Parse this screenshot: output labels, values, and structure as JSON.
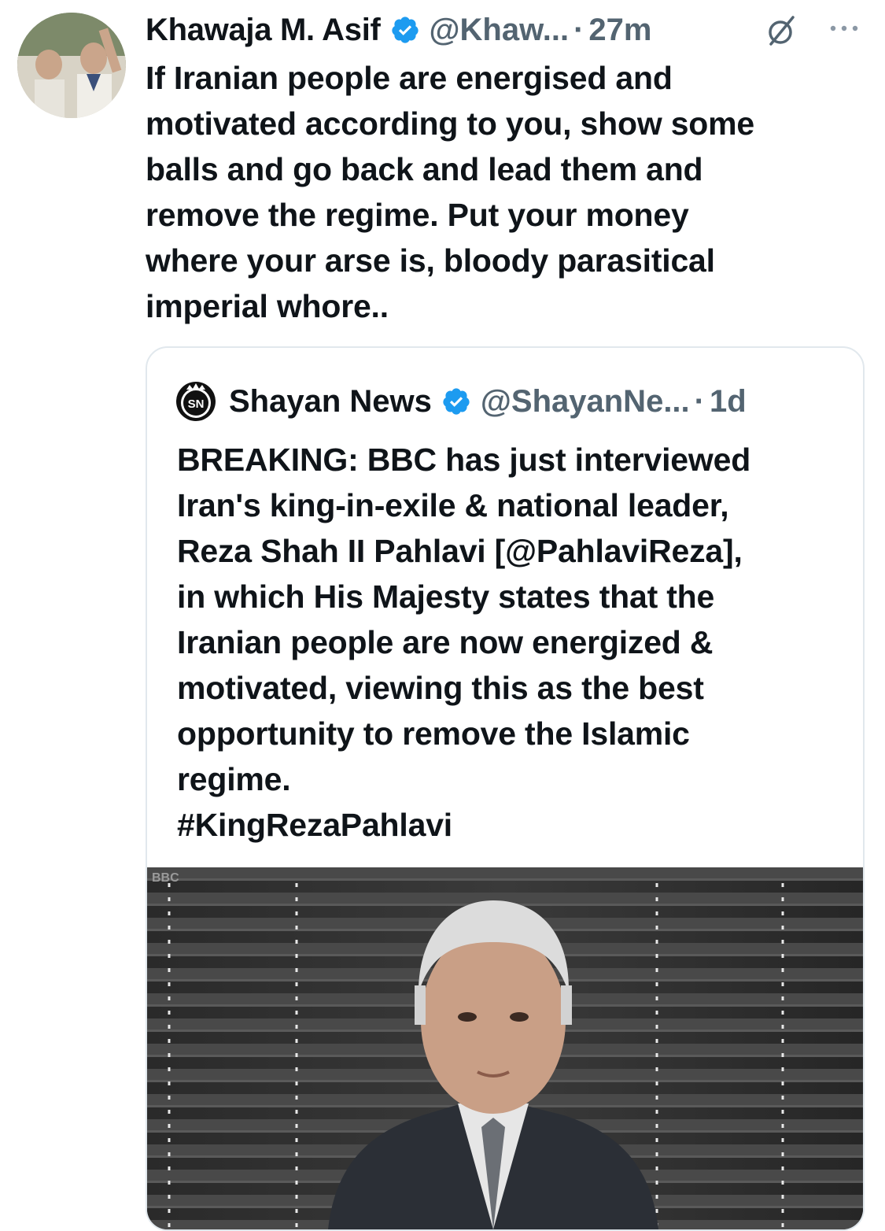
{
  "tweet": {
    "author_name": "Khawaja M. Asif",
    "handle": "@Khaw...",
    "separator": "·",
    "time": "27m",
    "text": "If Iranian people are energised and\nmotivated according to you, show some\nballs and go back and lead them and\nremove the regime. Put your money\nwhere your arse is, bloody parasitical\nimperial whore..",
    "icons": {
      "verified": "verified-badge-icon",
      "grok": "grok-icon",
      "more": "more-options-icon"
    }
  },
  "quoted": {
    "author_name": "Shayan News",
    "avatar_text": "SN",
    "handle": "@ShayanNe...",
    "separator": "·",
    "time": "1d",
    "text": "BREAKING: BBC has just interviewed\nIran's king-in-exile & national leader,\nReza Shah II Pahlavi [@PahlaviReza],\nin which His Majesty states that the\nIranian people are now energized &\nmotivated, viewing this as the best\nopportunity to remove the Islamic\nregime.\n#KingRezaPahlavi",
    "media_watermark": "BBC"
  },
  "colors": {
    "text_primary": "#0f1419",
    "text_secondary": "#536471",
    "verified_blue": "#1d9bf0",
    "border": "#e1e8ed"
  }
}
